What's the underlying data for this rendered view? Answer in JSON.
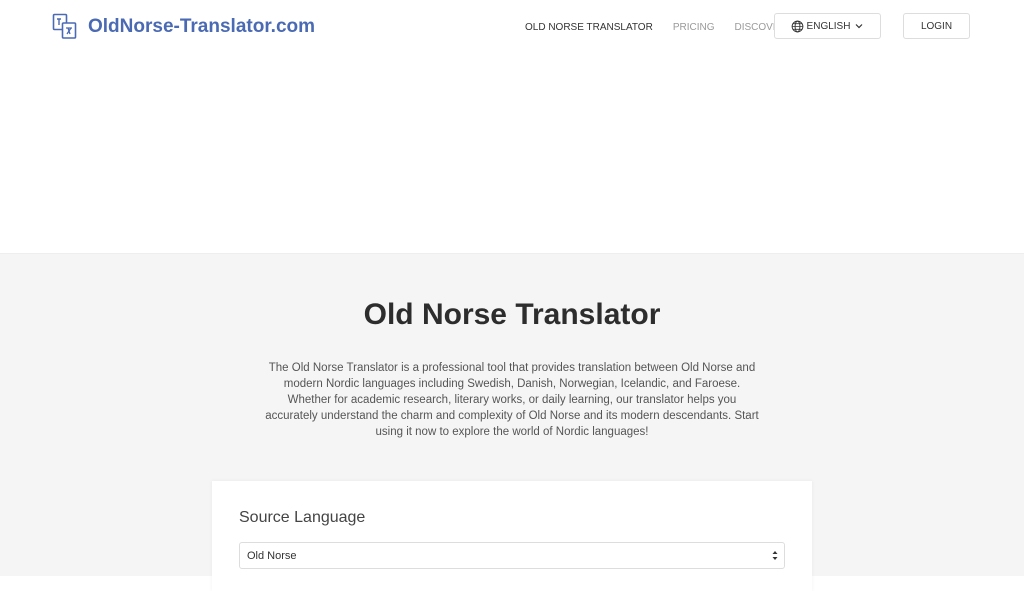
{
  "header": {
    "logo_text": "OldNorse-Translator.com",
    "nav": [
      {
        "label": "OLD NORSE TRANSLATOR",
        "active": true
      },
      {
        "label": "PRICING",
        "active": false
      },
      {
        "label": "DISCOVER",
        "active": false
      }
    ],
    "language_label": "ENGLISH",
    "login_label": "LOGIN"
  },
  "main": {
    "title": "Old Norse Translator",
    "description": "The Old Norse Translator is a professional tool that provides translation between Old Norse and modern Nordic languages including Swedish, Danish, Norwegian, Icelandic, and Faroese. Whether for academic research, literary works, or daily learning, our translator helps you accurately understand the charm and complexity of Old Norse and its modern descendants. Start using it now to explore the world of Nordic languages!"
  },
  "translator": {
    "source_label": "Source Language",
    "source_value": "Old Norse"
  },
  "colors": {
    "brand": "#4a6ab3",
    "background": "#f5f5f5"
  }
}
